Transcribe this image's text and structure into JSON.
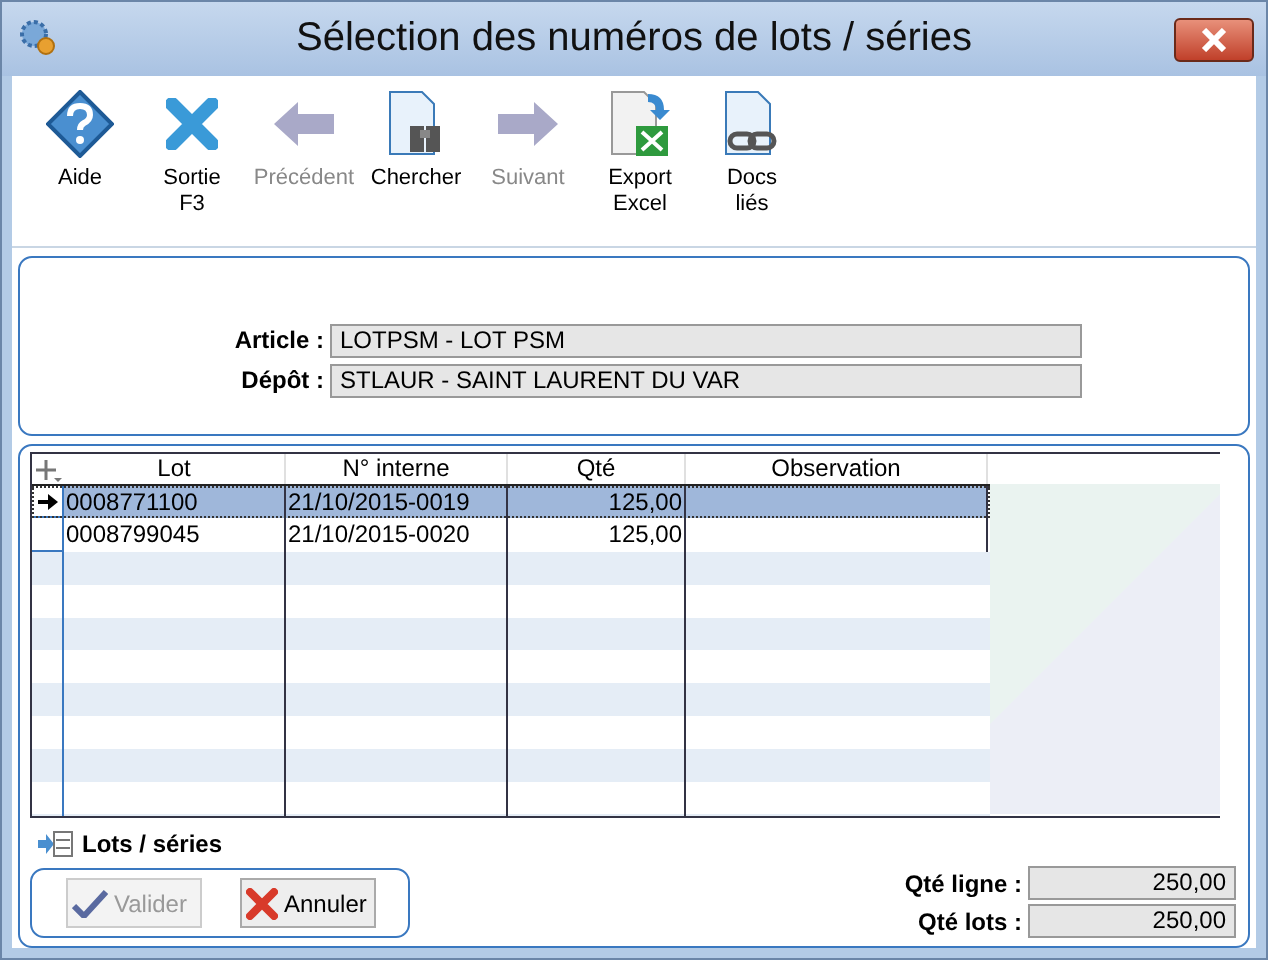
{
  "window": {
    "title": "Sélection des numéros de lots / séries"
  },
  "toolbar": [
    {
      "kind": "help",
      "label": "Aide",
      "disabled": false
    },
    {
      "kind": "exit",
      "label": "Sortie\nF3",
      "disabled": false
    },
    {
      "kind": "prev",
      "label": "Précédent",
      "disabled": true
    },
    {
      "kind": "search",
      "label": "Chercher",
      "disabled": false
    },
    {
      "kind": "next",
      "label": "Suivant",
      "disabled": true
    },
    {
      "kind": "excel",
      "label": "Export\nExcel",
      "disabled": false
    },
    {
      "kind": "docs",
      "label": "Docs\nliés",
      "disabled": false
    }
  ],
  "fields": [
    {
      "label": "Article :",
      "value": "LOTPSM - LOT PSM"
    },
    {
      "label": "Dépôt :",
      "value": "STLAUR - SAINT LAURENT DU VAR"
    }
  ],
  "table": {
    "columns": [
      "Lot",
      "N° interne",
      "Qté",
      "Observation"
    ],
    "rows": [
      {
        "cells": [
          "0008771100",
          "21/10/2015-0019",
          "125,00",
          ""
        ],
        "selected": true
      },
      {
        "cells": [
          "0008799045",
          "21/10/2015-0020",
          "125,00",
          ""
        ],
        "selected": false
      }
    ]
  },
  "section_label": "Lots / séries",
  "buttons": [
    {
      "kind": "ok",
      "label": "Valider",
      "disabled": true
    },
    {
      "kind": "cancel",
      "label": "Annuler",
      "disabled": false
    }
  ],
  "totals": [
    {
      "label": "Qté ligne :",
      "value": "250,00"
    },
    {
      "label": "Qté lots :",
      "value": "250,00"
    }
  ]
}
